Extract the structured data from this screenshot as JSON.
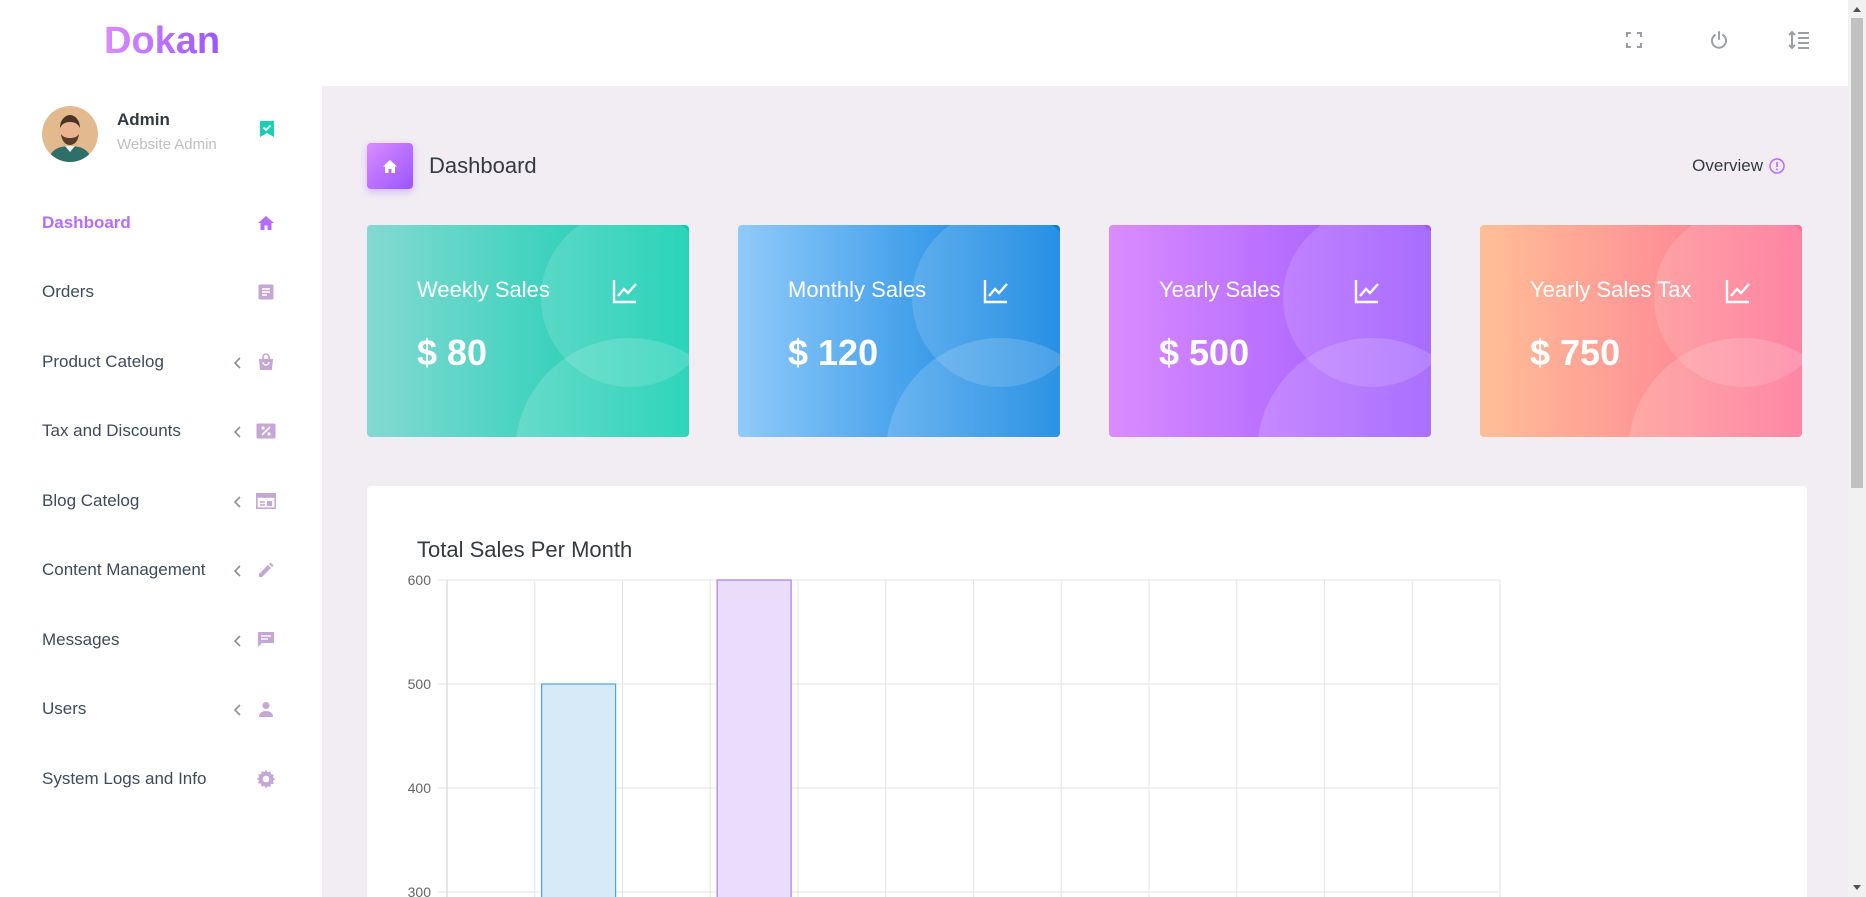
{
  "brand": "Dokan",
  "profile": {
    "name": "Admin",
    "role": "Website Admin"
  },
  "nav": [
    {
      "label": "Dashboard",
      "icon": "home-icon",
      "active": true,
      "submenu": false
    },
    {
      "label": "Orders",
      "icon": "clipboard-icon",
      "active": false,
      "submenu": false
    },
    {
      "label": "Product Catelog",
      "icon": "shopping-bag-icon",
      "active": false,
      "submenu": true
    },
    {
      "label": "Tax and Discounts",
      "icon": "percent-icon",
      "active": false,
      "submenu": true
    },
    {
      "label": "Blog Catelog",
      "icon": "blog-layout-icon",
      "active": false,
      "submenu": true
    },
    {
      "label": "Content Management",
      "icon": "pencil-icon",
      "active": false,
      "submenu": true
    },
    {
      "label": "Messages",
      "icon": "message-icon",
      "active": false,
      "submenu": true
    },
    {
      "label": "Users",
      "icon": "user-icon",
      "active": false,
      "submenu": true
    },
    {
      "label": "System Logs and Info",
      "icon": "gear-icon",
      "active": false,
      "submenu": false
    }
  ],
  "header": {
    "title": "Dashboard",
    "overview": "Overview"
  },
  "cards": [
    {
      "title": "Weekly Sales",
      "value": "$ 80",
      "gradient": [
        "#84d9d2",
        "#07cdae"
      ]
    },
    {
      "title": "Monthly Sales",
      "value": "$ 120",
      "gradient": [
        "#90caf9",
        "#047edf"
      ]
    },
    {
      "title": "Yearly Sales",
      "value": "$ 500",
      "gradient": [
        "#da8cff",
        "#9a55ff"
      ]
    },
    {
      "title": "Yearly Sales Tax",
      "value": "$ 750",
      "gradient": [
        "#ffbf96",
        "#fe7096"
      ]
    }
  ],
  "colors": {
    "accent": "#b66dff",
    "bg": "#f2edf3",
    "icon_muted": "#c5a6d6",
    "teal": "#1bcfb4"
  },
  "chart_data": {
    "type": "bar",
    "title": "Total Sales Per Month",
    "categories": [
      "",
      "",
      "",
      "",
      "",
      "",
      "",
      "",
      "",
      "",
      "",
      ""
    ],
    "values": [
      null,
      500,
      null,
      600,
      null,
      null,
      null,
      null,
      null,
      null,
      null,
      null
    ],
    "bar_colors": [
      null,
      "#d6eaf8",
      null,
      "#e9ddfb"
    ],
    "bar_borders": [
      null,
      "#4aa3e6",
      null,
      "#a97bf0"
    ],
    "yticks": [
      300,
      400,
      500,
      600
    ],
    "ylim": [
      300,
      600
    ],
    "grid": true
  }
}
